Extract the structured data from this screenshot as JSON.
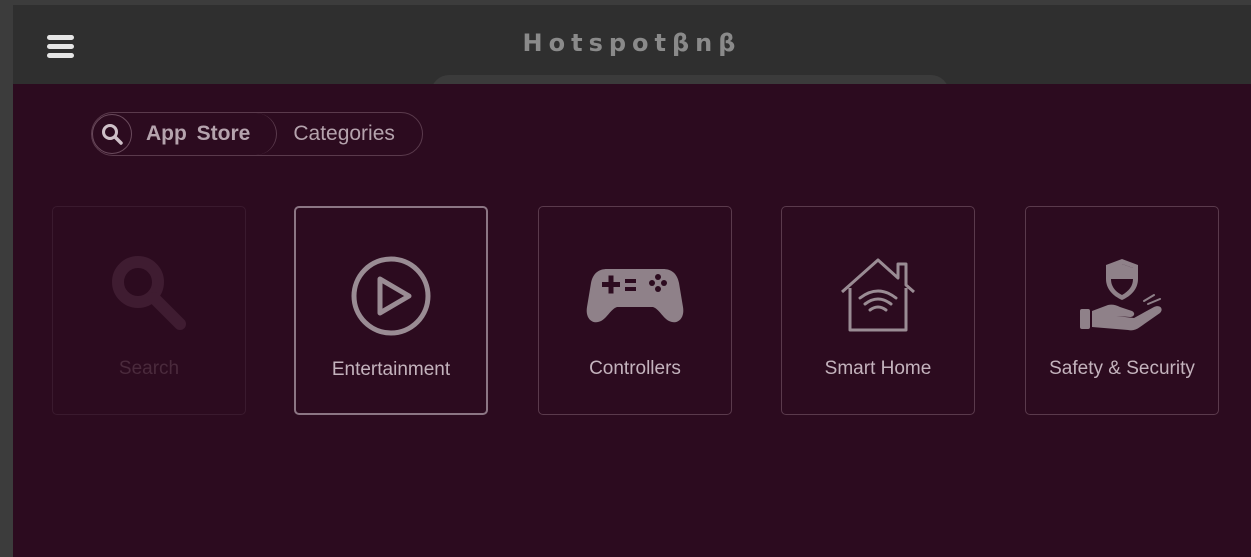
{
  "header": {
    "title": "Hotspotβnβ",
    "menu_icon": "hamburger-menu-icon"
  },
  "nav": {
    "search_icon": "search-icon",
    "app_store_label": "App Store",
    "categories_label": "Categories"
  },
  "categories": [
    {
      "label": "Search",
      "icon": "search-icon"
    },
    {
      "label": "Entertainment",
      "icon": "play-circle-icon"
    },
    {
      "label": "Controllers",
      "icon": "gamepad-icon"
    },
    {
      "label": "Smart Home",
      "icon": "smart-home-icon"
    },
    {
      "label": "Safety & Security",
      "icon": "shield-hand-icon"
    }
  ],
  "colors": {
    "background": "#2c0b1f",
    "header": "#2f2f2f",
    "icon": "#9a8c94"
  }
}
